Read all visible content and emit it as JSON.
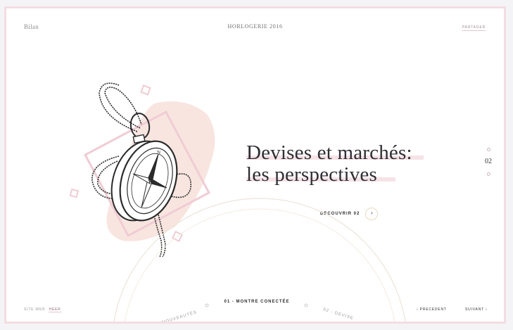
{
  "header": {
    "brand": "Bilan",
    "title": "HORLOGERIE 2016",
    "share_label": "PARTAGER"
  },
  "hero": {
    "headline_line1": "Devises et marchés:",
    "headline_line2": "les perspectives",
    "cta_label": "DECOUVRIR 02",
    "cta_icon": "chevron-right-icon"
  },
  "pager": {
    "current": "02"
  },
  "footer": {
    "site_label": "SITE WEB:",
    "site_link": "HEER",
    "prev_label": "PRECEDENT",
    "next_label": "SUIVANT",
    "wheel_center": "01 - MONTRE CONECTÉE",
    "wheel_left": "NOUVEAUTÉS",
    "wheel_right": "02 - DEVISE"
  },
  "colors": {
    "frame": "#f3dde2",
    "accent": "#e9d9c5",
    "highlight": "#f6e3e7"
  }
}
